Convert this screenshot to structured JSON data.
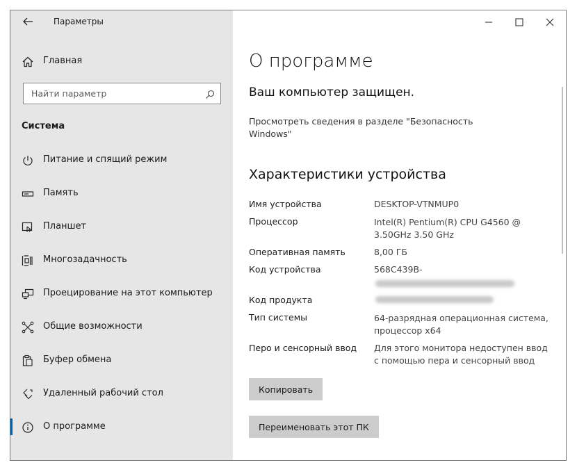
{
  "titlebar": {
    "title": "Параметры",
    "back_icon": "back-arrow-icon",
    "controls": [
      "minimize-icon",
      "maximize-icon",
      "close-icon"
    ]
  },
  "sidebar": {
    "home_label": "Главная",
    "search_placeholder": "Найти параметр",
    "section_title": "Система",
    "items": [
      {
        "label": "Питание и спящий режим",
        "icon": "power-icon"
      },
      {
        "label": "Память",
        "icon": "storage-icon"
      },
      {
        "label": "Планшет",
        "icon": "tablet-icon"
      },
      {
        "label": "Многозадачность",
        "icon": "multitasking-icon"
      },
      {
        "label": "Проецирование на этот компьютер",
        "icon": "projecting-icon"
      },
      {
        "label": "Общие возможности",
        "icon": "shared-experiences-icon"
      },
      {
        "label": "Буфер обмена",
        "icon": "clipboard-icon"
      },
      {
        "label": "Удаленный рабочий стол",
        "icon": "remote-desktop-icon"
      },
      {
        "label": "О программе",
        "icon": "info-icon",
        "active": true
      }
    ],
    "accent_color": "#0063b1"
  },
  "main": {
    "title": "О программе",
    "protected_heading": "Ваш компьютер защищен.",
    "security_link": "Просмотреть сведения в разделе \"Безопасность Windows\"",
    "specs_title": "Характеристики устройства",
    "specs": [
      {
        "label": "Имя устройства",
        "value": "DESKTOP-VTNMUP0"
      },
      {
        "label": "Процессор",
        "value": "Intel(R) Pentium(R) CPU G4560 @ 3.50GHz   3.50 GHz"
      },
      {
        "label": "Оперативная память",
        "value": "8,00 ГБ"
      },
      {
        "label": "Код устройства",
        "value": "568C439B-"
      },
      {
        "label": "Код продукта",
        "value": ""
      },
      {
        "label": "Тип системы",
        "value": "64-разрядная операционная система, процессор x64"
      },
      {
        "label": "Перо и сенсорный ввод",
        "value": "Для этого монитора недоступен ввод с помощью пера и сенсорный ввод"
      }
    ],
    "copy_button": "Копировать",
    "rename_button": "Переименовать этот ПК"
  }
}
